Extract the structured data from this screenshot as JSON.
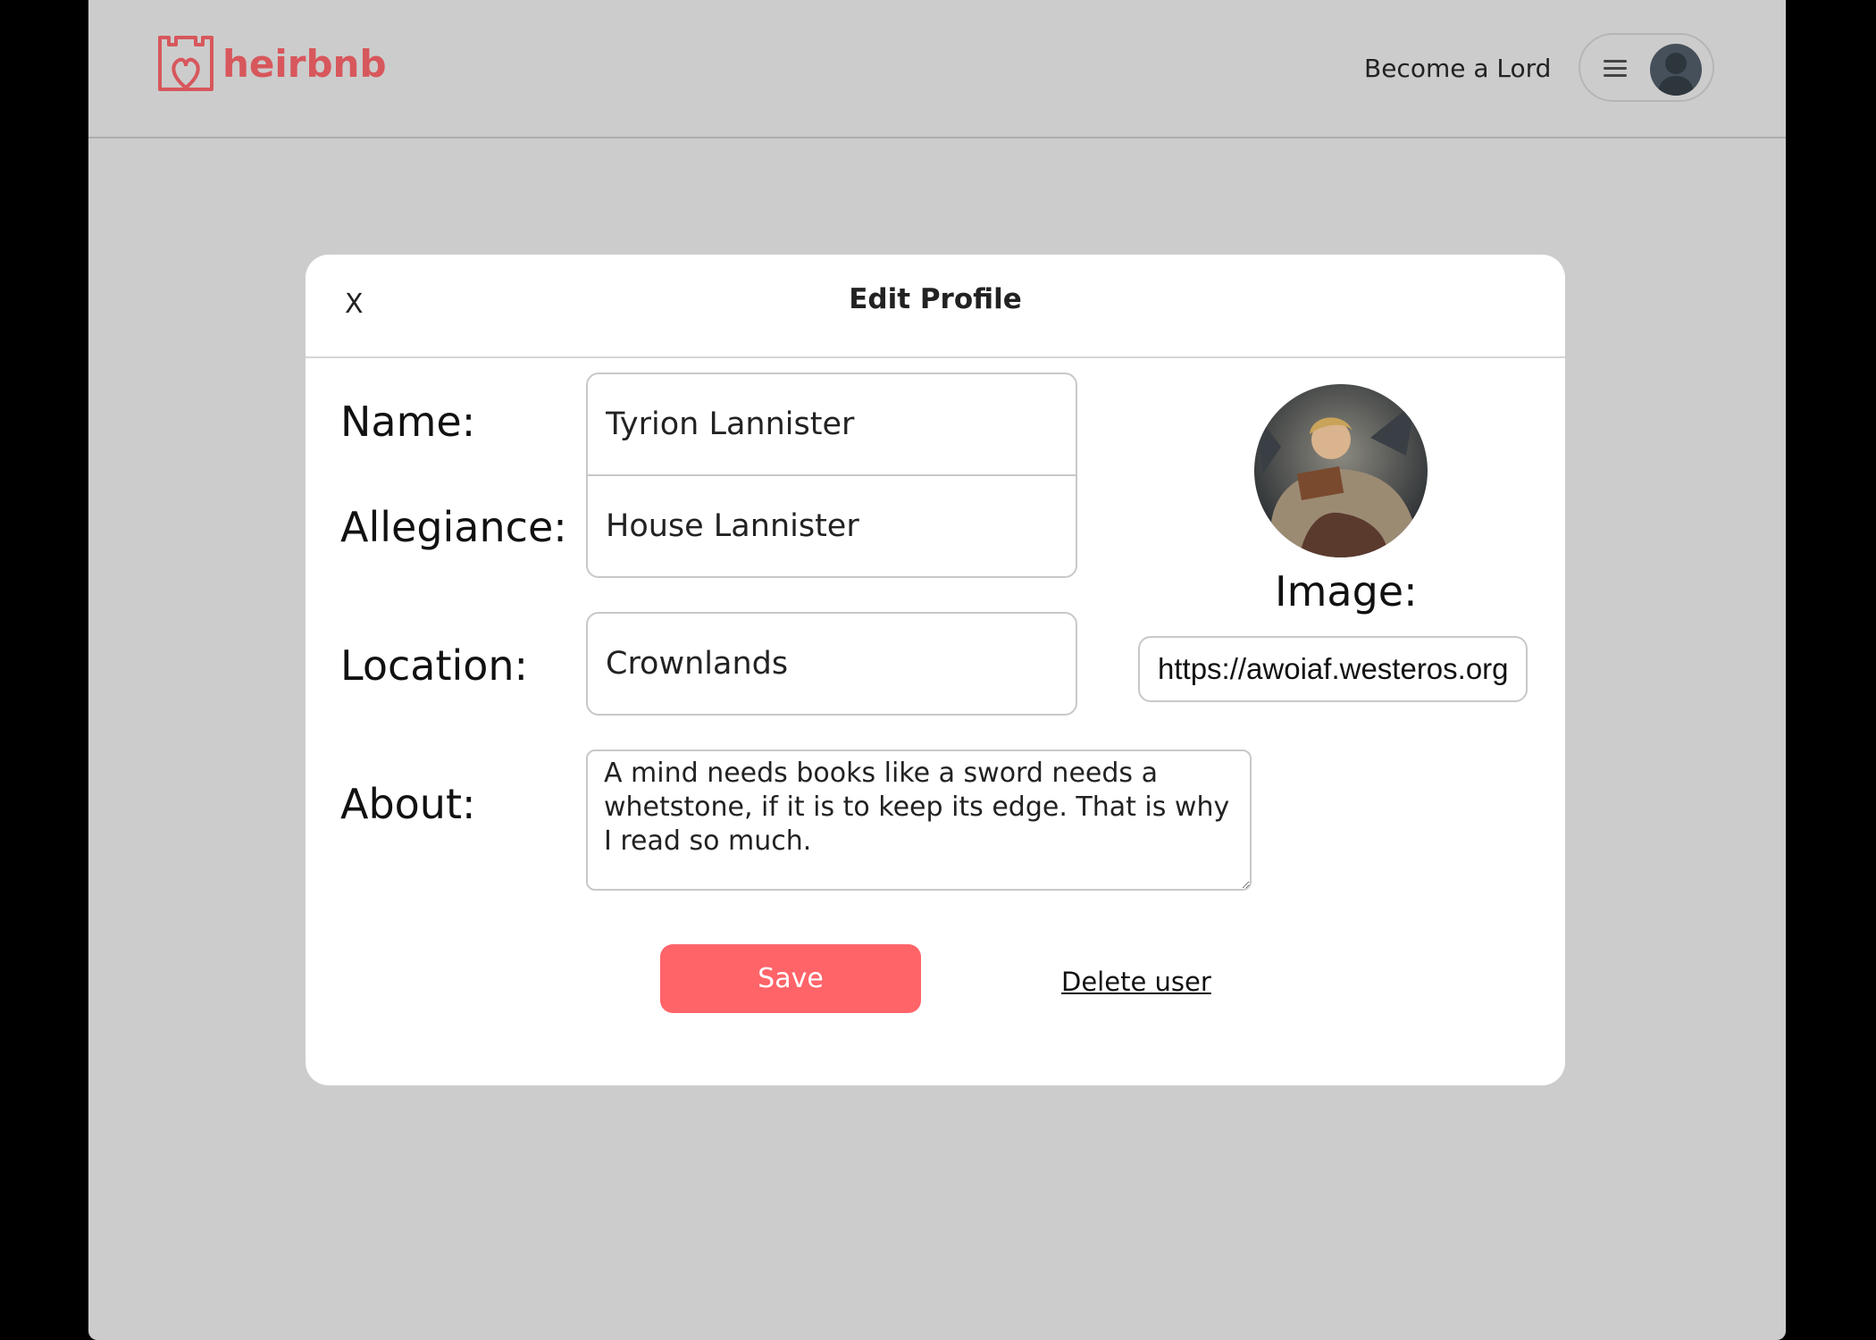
{
  "header": {
    "brand": "heirbnb",
    "become_lord": "Become a Lord",
    "brand_color": "#d7575c"
  },
  "modal": {
    "close_label": "X",
    "title": "Edit Profile",
    "name_label": "Name:",
    "name_value": "Tyrion Lannister",
    "allegiance_label": "Allegiance:",
    "allegiance_value": "House Lannister",
    "location_label": "Location:",
    "location_value": "Crownlands",
    "about_label": "About:",
    "about_value": "A mind needs books like a sword needs a whetstone, if it is to keep its edge. That is why I read so much.",
    "image_label": "Image:",
    "image_url": "https://awoiaf.westeros.org",
    "save_label": "Save",
    "delete_label": "Delete user",
    "save_color": "#ff6469"
  }
}
